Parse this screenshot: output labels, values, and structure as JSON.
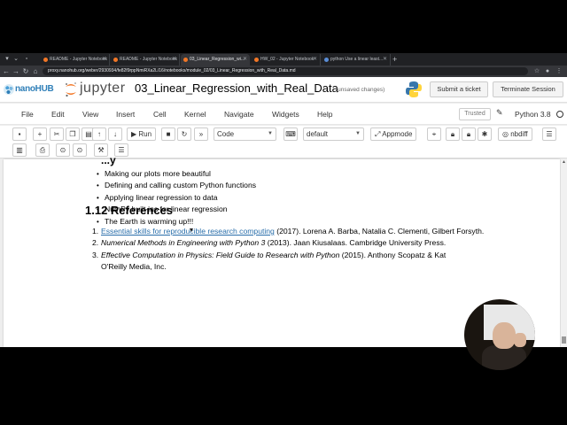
{
  "browser": {
    "tabs": [
      {
        "label": "README - Jupyter Notebook",
        "active": false
      },
      {
        "label": "README - Jupyter Notebook",
        "active": false
      },
      {
        "label": "03_Linear_Regression_wi...",
        "active": true
      },
      {
        "label": "HW_02 - Jupyter Notebook",
        "active": false
      },
      {
        "label": "python Use a linear least...",
        "active": false
      }
    ],
    "new_tab": "+",
    "url": "proxy.nanohub.org/weber/2930934/fe82f9rppNmiRXa2L/16/notebooks/module_02/03_Linear_Regression_with_Real_Data.md"
  },
  "header": {
    "brand": "nanoHUB",
    "jupyter": "jupyter",
    "notebook_title": "03_Linear_Regression_with_Real_Data",
    "save_status": "(unsaved changes)",
    "submit_ticket": "Submit a ticket",
    "terminate": "Terminate Session"
  },
  "menubar": {
    "items": [
      "File",
      "Edit",
      "View",
      "Insert",
      "Cell",
      "Kernel",
      "Navigate",
      "Widgets",
      "Help"
    ],
    "trusted": "Trusted",
    "kernel_name": "Python 3.8"
  },
  "toolbar": {
    "run_label": "Run",
    "cell_type": "Code",
    "celltoolbar": "default",
    "appmode": "Appmode",
    "nbdiff": "nbdiff"
  },
  "notebook": {
    "partial_heading": "...y",
    "bullets": [
      "Making our plots more beautiful",
      "Defining and calling custom Python functions",
      "Applying linear regression to data",
      "NumPy built-ins for linear regression",
      "The Earth is warming up!!!"
    ],
    "section_heading": "1.12  References",
    "refs": [
      {
        "num": "1.",
        "link": "Essential skills for reproducible research computing",
        "rest": " (2017). Lorena A. Barba, Natalia C. Clementi, Gilbert Forsyth."
      },
      {
        "num": "2.",
        "italic": "Numerical Methods in Engineering with Python 3",
        "rest": " (2013). Jaan Kiusalaas. Cambridge University Press."
      },
      {
        "num": "3.",
        "italic": "Effective Computation in Physics: Field Guide to Research with Python",
        "rest": " (2015). Anthony Scopatz & Kat"
      }
    ],
    "ref3_cont": "O'Reilly Media, Inc."
  }
}
